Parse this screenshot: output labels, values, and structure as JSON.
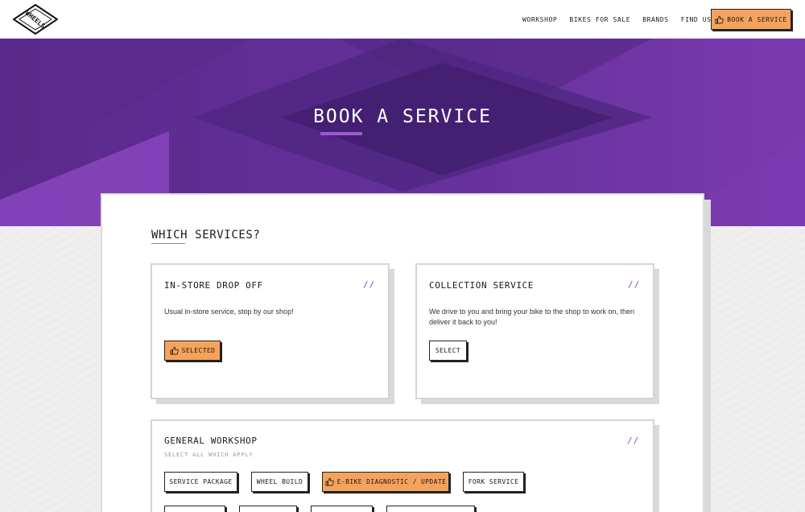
{
  "header": {
    "logo_text": "WHEELS",
    "nav": [
      "WORKSHOP",
      "BIKES FOR SALE",
      "BRANDS",
      "FIND US"
    ],
    "cta_label": "BOOK A SERVICE",
    "cta_icon": "thumbs-up-icon"
  },
  "hero": {
    "title": "BOOK A SERVICE"
  },
  "colors": {
    "accent_orange": "#f5a35c",
    "hero_purple": "#63309a",
    "slash_purple": "#8a4ec6"
  },
  "services": {
    "title": "WHICH SERVICES?",
    "options": [
      {
        "title": "IN-STORE DROP OFF",
        "slashes": "//",
        "description": "Usual in-store service, stop by our shop!",
        "button": "SELECTED",
        "selected": true
      },
      {
        "title": "COLLECTION SERVICE",
        "slashes": "//",
        "description": "We drive to you and bring your bike to the shop to work on, then deliver it back to you!",
        "button": "SELECT",
        "selected": false
      }
    ]
  },
  "workshop": {
    "title": "GENERAL WORKSHOP",
    "slashes": "//",
    "subtitle": "SELECT ALL WHICH APPLY",
    "options": [
      {
        "label": "SERVICE PACKAGE",
        "selected": false
      },
      {
        "label": "WHEEL BUILD",
        "selected": false
      },
      {
        "label": "E-BIKE DIAGNOSTIC / UPDATE",
        "selected": true
      },
      {
        "label": "FORK SERVICE",
        "selected": false
      }
    ]
  }
}
